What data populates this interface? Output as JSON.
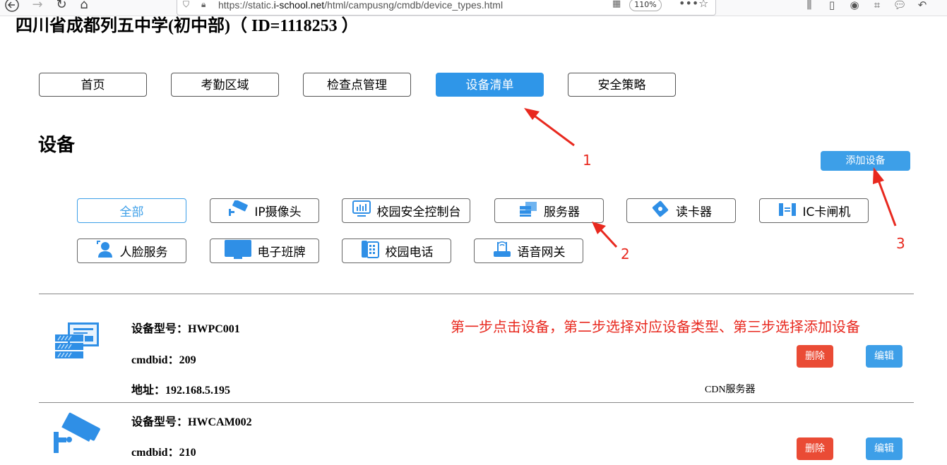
{
  "browser": {
    "url_prefix": "https://static.",
    "url_domain": "i-school.net",
    "url_path": "/html/campusng/cmdb/device_types.html",
    "zoom": "110%"
  },
  "school_title": "四川省成都列五中学(初中部)（ ID=1118253 ）",
  "nav": [
    {
      "label": "首页",
      "active": false
    },
    {
      "label": "考勤区域",
      "active": false
    },
    {
      "label": "检查点管理",
      "active": false
    },
    {
      "label": "设备清单",
      "active": true
    },
    {
      "label": "安全策略",
      "active": false
    }
  ],
  "section_title": "设备",
  "add_device_label": "添加设备",
  "device_types": [
    {
      "label": "全部",
      "icon": "none"
    },
    {
      "label": "IP摄像头",
      "icon": "camera-icon"
    },
    {
      "label": "校园安全控制台",
      "icon": "console-icon"
    },
    {
      "label": "服务器",
      "icon": "server-icon"
    },
    {
      "label": "读卡器",
      "icon": "card-reader-icon"
    },
    {
      "label": "IC卡闸机",
      "icon": "gate-icon"
    },
    {
      "label": "人脸服务",
      "icon": "face-icon"
    },
    {
      "label": "电子班牌",
      "icon": "screen-icon"
    },
    {
      "label": "校园电话",
      "icon": "phone-icon"
    },
    {
      "label": "语音网关",
      "icon": "gateway-icon"
    }
  ],
  "devices": [
    {
      "model_label": "设备型号：",
      "model": "HWPC001",
      "cmdbid_label": "cmdbid：",
      "cmdbid": "209",
      "address_label": "地址：",
      "address": "192.168.5.195",
      "category": "CDN服务器",
      "delete_label": "删除",
      "edit_label": "编辑",
      "icon": "server-icon"
    },
    {
      "model_label": "设备型号：",
      "model": "HWCAM002",
      "cmdbid_label": "cmdbid：",
      "cmdbid": "210",
      "delete_label": "删除",
      "edit_label": "编辑",
      "icon": "camera-icon"
    }
  ],
  "annotations": {
    "num1": "1",
    "num2": "2",
    "num3": "3",
    "instruction": "第一步点击设备，第二步选择对应设备类型、第三步选择添加设备"
  },
  "colors": {
    "accent": "#2f96e8",
    "danger": "#ea4b35",
    "annotation": "#e8291f"
  }
}
